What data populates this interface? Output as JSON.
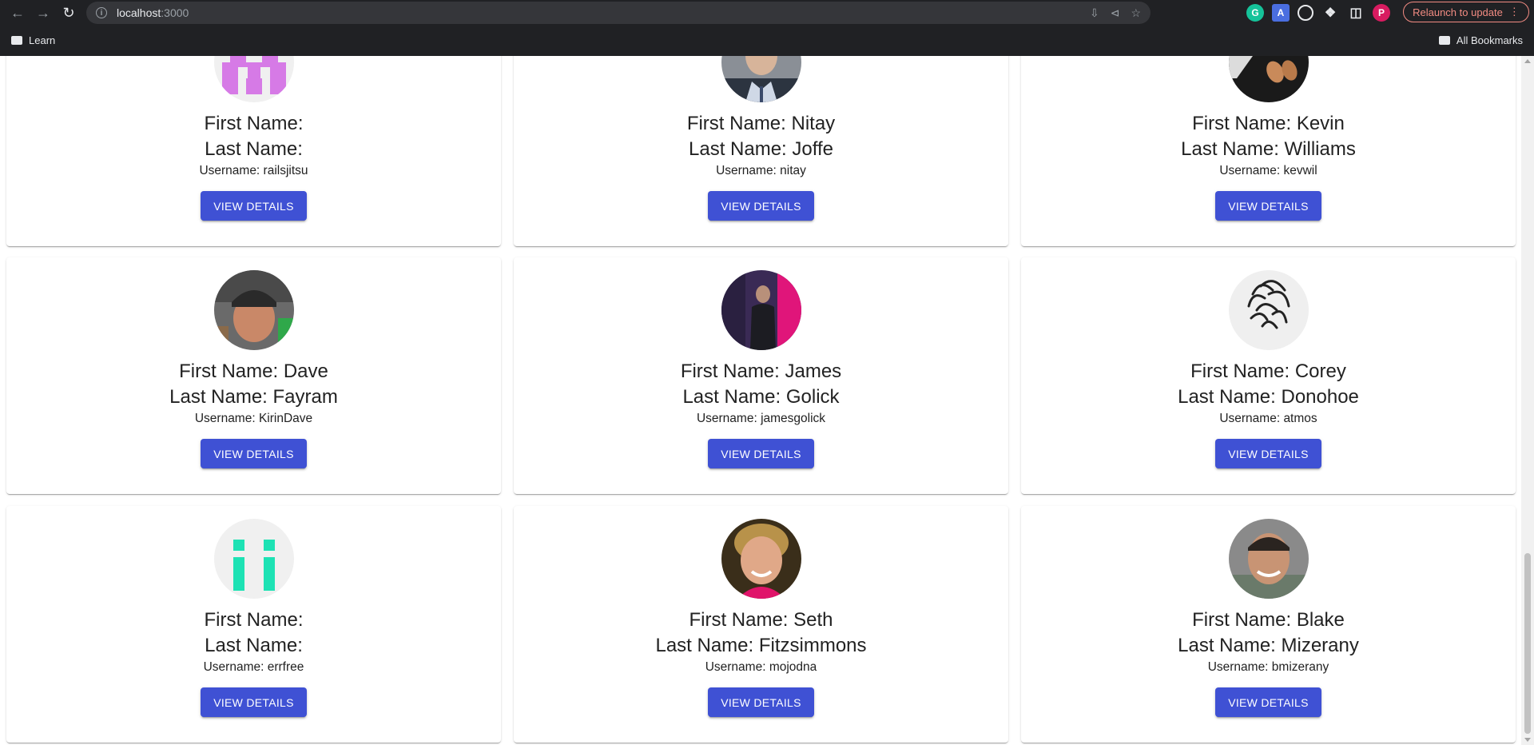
{
  "browser": {
    "url_host": "localhost",
    "url_port": ":3000",
    "relaunch_label": "Relaunch to update",
    "profile_initial": "P",
    "bookmark_folder": "Learn",
    "all_bookmarks": "All Bookmarks"
  },
  "view_details_label": "VIEW DETAILS",
  "users": [
    {
      "first": "First Name: ",
      "last": "Last Name: ",
      "username": "Username: railsjitsu",
      "avatar": "identicon-purple"
    },
    {
      "first": "First Name: Nitay",
      "last": "Last Name: Joffe",
      "username": "Username: nitay",
      "avatar": "photo-man-suit"
    },
    {
      "first": "First Name: Kevin",
      "last": "Last Name: Williams",
      "username": "Username: kevwil",
      "avatar": "photo-keyboard"
    },
    {
      "first": "First Name: Dave",
      "last": "Last Name: Fayram",
      "username": "Username: KirinDave",
      "avatar": "photo-pixelated"
    },
    {
      "first": "First Name: James",
      "last": "Last Name: Golick",
      "username": "Username: jamesgolick",
      "avatar": "photo-speaker-stage"
    },
    {
      "first": "First Name: Corey",
      "last": "Last Name: Donohoe",
      "username": "Username: atmos",
      "avatar": "photo-sketch-hair"
    },
    {
      "first": "First Name: ",
      "last": "Last Name: ",
      "username": "Username: errfree",
      "avatar": "identicon-teal"
    },
    {
      "first": "First Name: Seth",
      "last": "Last Name: Fitzsimmons",
      "username": "Username: mojodna",
      "avatar": "photo-smiling-man"
    },
    {
      "first": "First Name: Blake",
      "last": "Last Name: Mizerany",
      "username": "Username: bmizerany",
      "avatar": "photo-man-outdoors"
    }
  ],
  "colors": {
    "button": "#3f51d4",
    "chrome_bg": "#202124",
    "relaunch": "#f28b82"
  }
}
